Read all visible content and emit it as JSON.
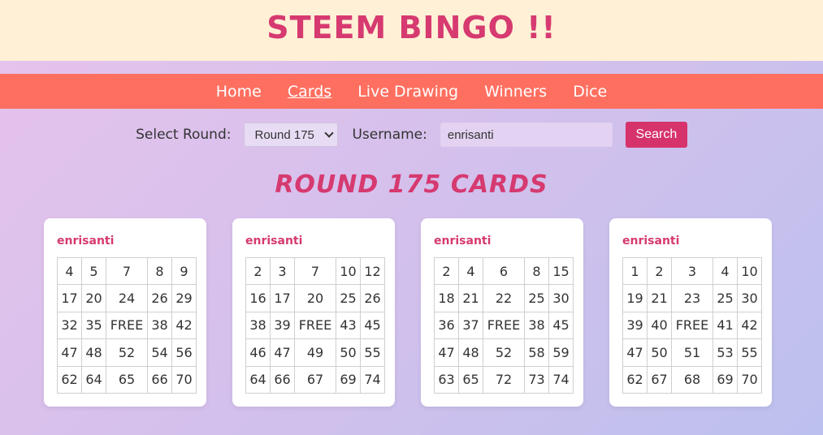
{
  "header": {
    "title": "STEEM BINGO !!"
  },
  "nav": {
    "items": [
      {
        "label": "Home",
        "active": false
      },
      {
        "label": "Cards",
        "active": true
      },
      {
        "label": "Live Drawing",
        "active": false
      },
      {
        "label": "Winners",
        "active": false
      },
      {
        "label": "Dice",
        "active": false
      }
    ]
  },
  "controls": {
    "round_label": "Select Round:",
    "round_value": "Round 175",
    "username_label": "Username:",
    "username_value": "enrisanti",
    "search_label": "Search"
  },
  "round_title": "ROUND 175 CARDS",
  "cards": [
    {
      "username": "enrisanti",
      "rows": [
        [
          "4",
          "5",
          "7",
          "8",
          "9"
        ],
        [
          "17",
          "20",
          "24",
          "26",
          "29"
        ],
        [
          "32",
          "35",
          "FREE",
          "38",
          "42"
        ],
        [
          "47",
          "48",
          "52",
          "54",
          "56"
        ],
        [
          "62",
          "64",
          "65",
          "66",
          "70"
        ]
      ]
    },
    {
      "username": "enrisanti",
      "rows": [
        [
          "2",
          "3",
          "7",
          "10",
          "12"
        ],
        [
          "16",
          "17",
          "20",
          "25",
          "26"
        ],
        [
          "38",
          "39",
          "FREE",
          "43",
          "45"
        ],
        [
          "46",
          "47",
          "49",
          "50",
          "55"
        ],
        [
          "64",
          "66",
          "67",
          "69",
          "74"
        ]
      ]
    },
    {
      "username": "enrisanti",
      "rows": [
        [
          "2",
          "4",
          "6",
          "8",
          "15"
        ],
        [
          "18",
          "21",
          "22",
          "25",
          "30"
        ],
        [
          "36",
          "37",
          "FREE",
          "38",
          "45"
        ],
        [
          "47",
          "48",
          "52",
          "58",
          "59"
        ],
        [
          "63",
          "65",
          "72",
          "73",
          "74"
        ]
      ]
    },
    {
      "username": "enrisanti",
      "rows": [
        [
          "1",
          "2",
          "3",
          "4",
          "10"
        ],
        [
          "19",
          "21",
          "23",
          "25",
          "30"
        ],
        [
          "39",
          "40",
          "FREE",
          "41",
          "42"
        ],
        [
          "47",
          "50",
          "51",
          "53",
          "55"
        ],
        [
          "62",
          "67",
          "68",
          "69",
          "70"
        ]
      ]
    }
  ]
}
